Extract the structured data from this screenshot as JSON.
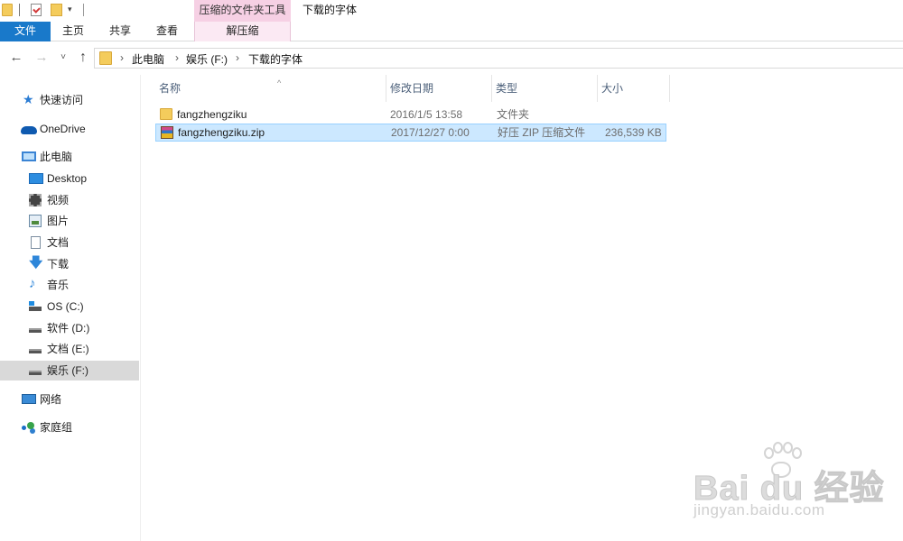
{
  "titlebar": {
    "context_tab_group": "压缩的文件夹工具",
    "window_title": "下载的字体",
    "qat_dropdown": "▾"
  },
  "ribbon": {
    "tabs": [
      {
        "label": "文件",
        "active": true
      },
      {
        "label": "主页"
      },
      {
        "label": "共享"
      },
      {
        "label": "查看"
      },
      {
        "label": "解压缩"
      }
    ],
    "colors": {
      "file_tab": "#1979ca",
      "context_group": "#f6d0e4"
    }
  },
  "navigation": {
    "back": "←",
    "forward": "→",
    "recent": "˅",
    "up": "↑"
  },
  "address": {
    "separator": "›",
    "breadcrumbs": [
      "此电脑",
      "娱乐 (F:)",
      "下载的字体"
    ]
  },
  "sidebar": {
    "items": [
      {
        "label": "快速访问",
        "icon": "star-icon"
      },
      {
        "label": "OneDrive",
        "icon": "cloud-icon"
      },
      {
        "label": "此电脑",
        "icon": "computer-icon"
      },
      {
        "label": "Desktop",
        "icon": "desktop-icon"
      },
      {
        "label": "视频",
        "icon": "video-icon"
      },
      {
        "label": "图片",
        "icon": "pictures-icon"
      },
      {
        "label": "文档",
        "icon": "documents-icon"
      },
      {
        "label": "下载",
        "icon": "download-icon",
        "glyph": "🡇"
      },
      {
        "label": "音乐",
        "icon": "music-icon",
        "glyph": "♪"
      },
      {
        "label": "OS (C:)",
        "icon": "os-drive-icon"
      },
      {
        "label": "软件 (D:)",
        "icon": "drive-icon"
      },
      {
        "label": "文档 (E:)",
        "icon": "drive-icon"
      },
      {
        "label": "娱乐 (F:)",
        "icon": "drive-icon",
        "selected": true
      },
      {
        "label": "网络",
        "icon": "network-icon"
      },
      {
        "label": "家庭组",
        "icon": "homegroup-icon"
      }
    ],
    "star_glyph": "★"
  },
  "file_list": {
    "sort_glyph": "^",
    "columns": [
      "名称",
      "修改日期",
      "类型",
      "大小"
    ],
    "rows": [
      {
        "name": "fangzhengziku",
        "date": "2016/1/5 13:58",
        "type": "文件夹",
        "size": "",
        "icon": "folder-icon"
      },
      {
        "name": "fangzhengziku.zip",
        "date": "2017/12/27 0:00",
        "type": "好压 ZIP 压缩文件",
        "size": "236,539 KB",
        "icon": "zip-archive-icon",
        "selected": true
      }
    ]
  },
  "watermark": {
    "brand": "Bai du 经验",
    "url": "jingyan.baidu.com"
  }
}
